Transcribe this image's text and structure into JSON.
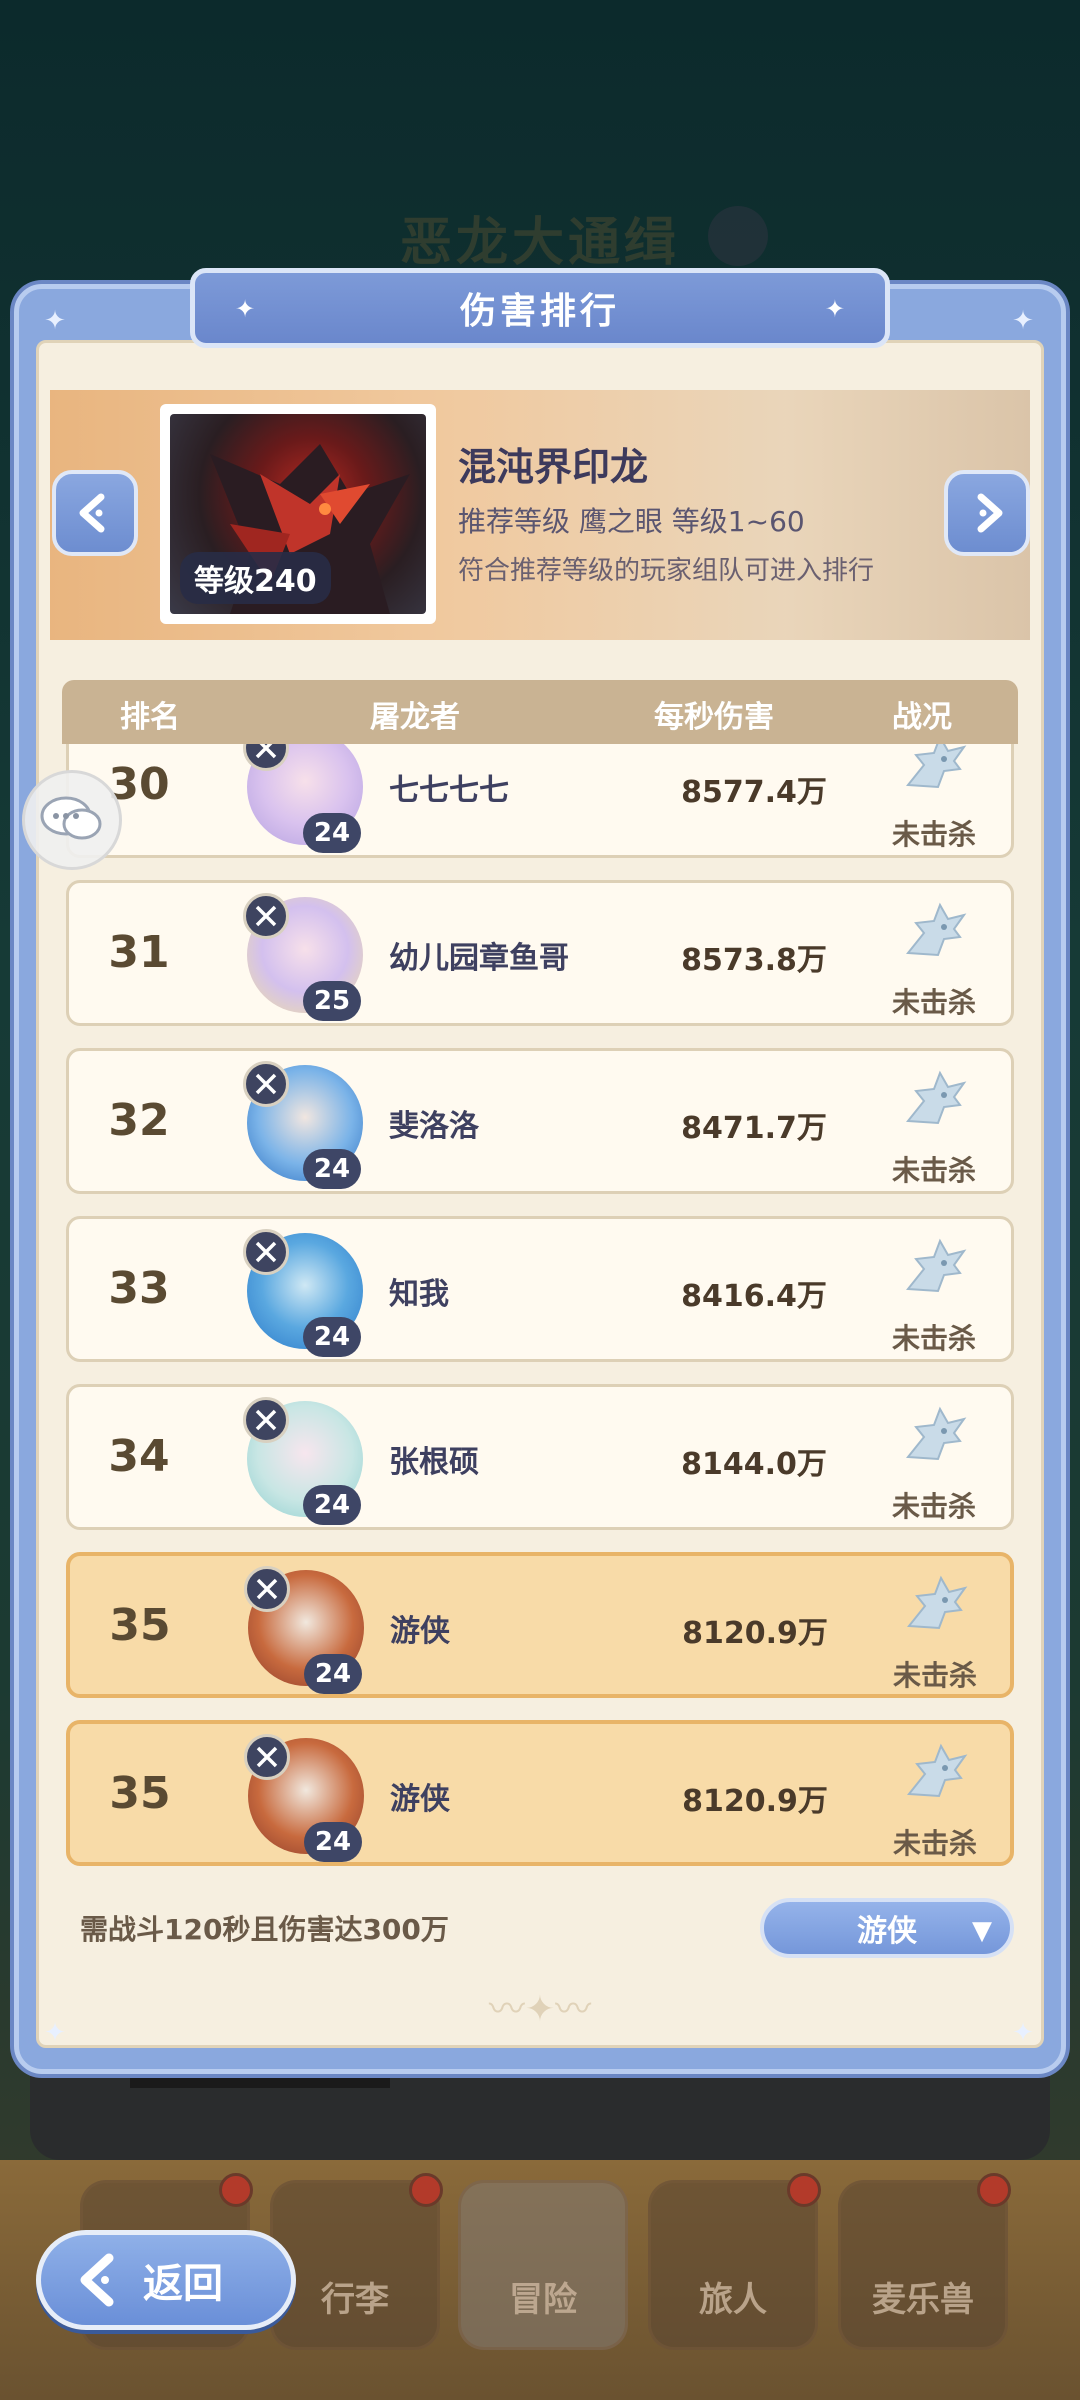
{
  "background": {
    "title": "恶龙大通缉"
  },
  "modal": {
    "title": "伤害排行"
  },
  "boss": {
    "name": "混沌界印龙",
    "level_badge": "等级240",
    "recommend": "推荐等级  鹰之眼  等级1~60",
    "tip": "符合推荐等级的玩家组队可进入排行"
  },
  "table": {
    "headers": [
      "排名",
      "屠龙者",
      "每秒伤害",
      "战况"
    ],
    "rows": [
      {
        "rank": "30",
        "name": "七七七七",
        "level": "24",
        "dps": "8577.4万",
        "status": "未击杀",
        "self": false
      },
      {
        "rank": "31",
        "name": "幼儿园章鱼哥",
        "level": "25",
        "dps": "8573.8万",
        "status": "未击杀",
        "self": false
      },
      {
        "rank": "32",
        "name": "斐洛洛",
        "level": "24",
        "dps": "8471.7万",
        "status": "未击杀",
        "self": false
      },
      {
        "rank": "33",
        "name": "知我",
        "level": "24",
        "dps": "8416.4万",
        "status": "未击杀",
        "self": false
      },
      {
        "rank": "34",
        "name": "张根硕",
        "level": "24",
        "dps": "8144.0万",
        "status": "未击杀",
        "self": false
      },
      {
        "rank": "35",
        "name": "游侠",
        "level": "24",
        "dps": "8120.9万",
        "status": "未击杀",
        "self": true
      }
    ],
    "pinned_self": {
      "rank": "35",
      "name": "游侠",
      "level": "24",
      "dps": "8120.9万",
      "status": "未击杀"
    }
  },
  "footer": {
    "note": "需战斗120秒且伤害达300万",
    "class_select": "游侠"
  },
  "bottom_nav": {
    "back": "返回",
    "tabs": [
      "行李",
      "冒险",
      "旅人",
      "麦乐兽"
    ]
  },
  "colors": {
    "modal_blue": "#8aa8de",
    "parchment": "#f6efe0",
    "self_highlight": "#f8dba8"
  }
}
